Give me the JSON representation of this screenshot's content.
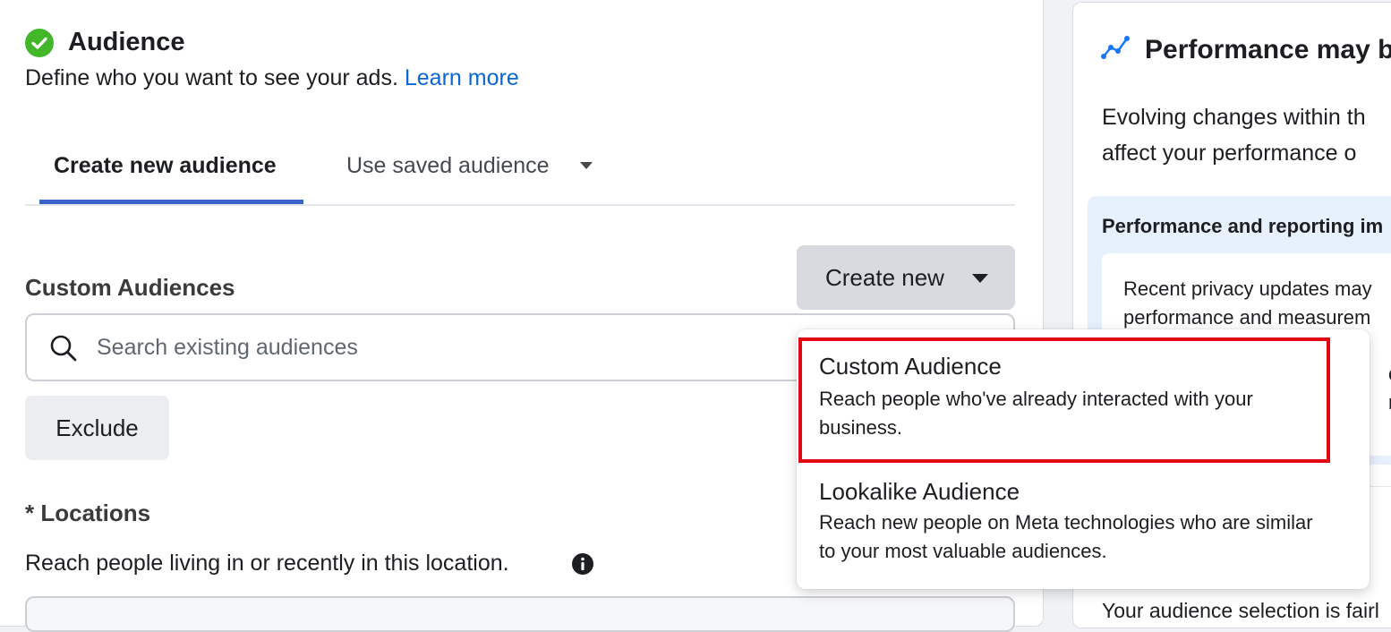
{
  "audience": {
    "title": "Audience",
    "description": "Define who you want to see your ads.",
    "learn_more": "Learn more"
  },
  "tabs": {
    "create_new": "Create new audience",
    "use_saved": "Use saved audience"
  },
  "custom_audiences": {
    "label": "Custom Audiences",
    "create_new_button": "Create new",
    "search_placeholder": "Search existing audiences",
    "exclude_button": "Exclude"
  },
  "locations": {
    "label": "* Locations",
    "description": "Reach people living in or recently in this location."
  },
  "dropdown": {
    "items": [
      {
        "title": "Custom Audience",
        "description": "Reach people who've already interacted with your business."
      },
      {
        "title": "Lookalike Audience",
        "description": "Reach new people on Meta technologies who are similar to your most valuable audiences."
      }
    ]
  },
  "performance": {
    "title": "Performance may b",
    "text_line1": "Evolving changes within th",
    "text_line2": "affect your performance o",
    "notice_title": "Performance and reporting im",
    "notice_line1": "Recent privacy updates may",
    "notice_line2": "performance and measurem",
    "notice_frag1": "om",
    "notice_frag2": "r c",
    "bottom_text": "Your audience selection is fairl"
  },
  "colors": {
    "link": "#0a66d2",
    "success": "#42b72a",
    "tab_active": "#3b62c9",
    "highlight": "#e30613",
    "perf_icon": "#1877f2"
  },
  "icons": {
    "status": "check-circle-icon",
    "search": "search-icon",
    "info": "info-icon",
    "performance": "performance-chart-icon"
  }
}
